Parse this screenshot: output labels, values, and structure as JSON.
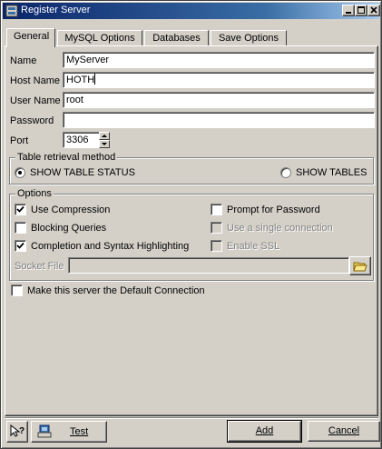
{
  "window": {
    "title": "Register Server"
  },
  "tabs": [
    {
      "label": "General"
    },
    {
      "label": "MySQL Options"
    },
    {
      "label": "Databases"
    },
    {
      "label": "Save Options"
    }
  ],
  "fields": {
    "name": {
      "label": "Name",
      "value": "MyServer"
    },
    "host": {
      "label": "Host Name",
      "value": "HOTH"
    },
    "user": {
      "label": "User Name",
      "value": "root"
    },
    "password": {
      "label": "Password",
      "value": ""
    },
    "port": {
      "label": "Port",
      "value": "3306"
    }
  },
  "retrieval": {
    "title": "Table retrieval method",
    "options": [
      {
        "label": "SHOW TABLE STATUS",
        "selected": true
      },
      {
        "label": "SHOW TABLES",
        "selected": false
      }
    ]
  },
  "options": {
    "title": "Options",
    "use_compression": {
      "label": "Use Compression",
      "checked": true
    },
    "blocking_queries": {
      "label": "Blocking Queries",
      "checked": false
    },
    "completion": {
      "label": "Completion and Syntax Highlighting",
      "checked": true
    },
    "prompt_password": {
      "label": "Prompt for Password",
      "checked": false
    },
    "single_connection": {
      "label": "Use a single connection",
      "checked": false
    },
    "enable_ssl": {
      "label": "Enable SSL",
      "checked": false
    },
    "socket_file": {
      "label": "Socket File",
      "value": ""
    }
  },
  "default_connection": {
    "label": "Make this server the Default Connection",
    "checked": false
  },
  "buttons": {
    "test": "Test",
    "add": "Add",
    "cancel": "Cancel"
  }
}
